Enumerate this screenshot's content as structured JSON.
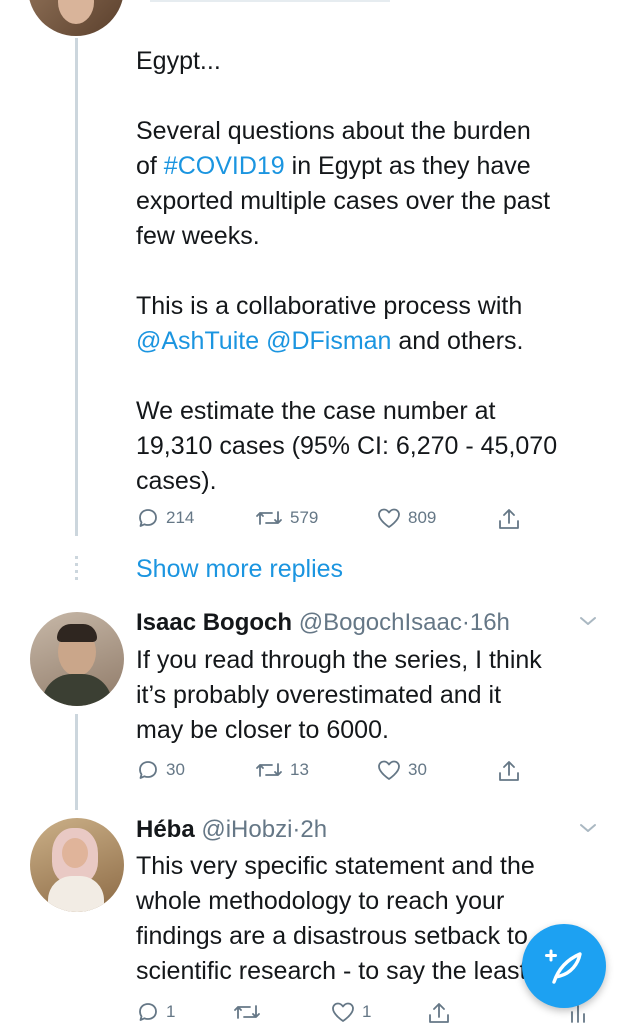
{
  "tweet1": {
    "line_intro": "Egypt...",
    "para2_a": "Several questions about the burden",
    "para2_b_pre": "of ",
    "para2_hashtag": "#COVID19",
    "para2_b_post": " in Egypt as they have",
    "para2_c": "exported multiple cases over the past",
    "para2_d": "few weeks.",
    "para3_a": "This is a collaborative process with",
    "para3_mention1": "@AshTuite",
    "para3_mention2": "@DFisman",
    "para3_post": " and others.",
    "para4_a": "We estimate the case number at",
    "para4_b": "19,310 cases (95% CI: 6,270 - 45,070",
    "para4_c": "cases).",
    "replies": "214",
    "retweets": "579",
    "likes": "809"
  },
  "show_more": "Show more replies",
  "tweet2": {
    "name": "Isaac Bogoch",
    "handle": "@BogochIsaac",
    "time": "16h",
    "text_a": "If you read through the series, I think",
    "text_b": "it’s probably overestimated and it",
    "text_c": "may be closer to 6000.",
    "replies": "30",
    "retweets": "13",
    "likes": "30"
  },
  "tweet3": {
    "name": "Héba",
    "handle": "@iHobzi",
    "time": "2h",
    "text_a": "This very specific statement and the",
    "text_b": "whole methodology to reach your",
    "text_c": "findings are a disastrous setback to",
    "text_d": "scientific research - to say the least",
    "replies": "1",
    "likes": "1"
  },
  "icons": {
    "reply": "reply-icon",
    "retweet": "retweet-icon",
    "like": "heart-icon",
    "share": "share-icon",
    "chevron": "chevron-down-icon",
    "compose": "compose-tweet-icon"
  },
  "colors": {
    "link": "#1b95e0",
    "muted": "#657786",
    "fab": "#1da1f2"
  }
}
